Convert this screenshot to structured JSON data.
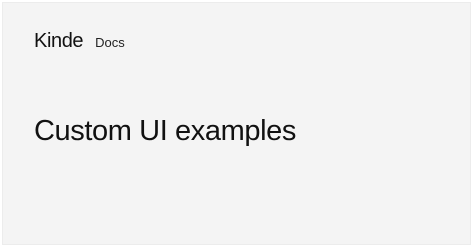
{
  "header": {
    "logo_text": "Kinde",
    "section_label": "Docs"
  },
  "main": {
    "title": "Custom UI examples"
  },
  "colors": {
    "background": "#f4f4f4",
    "text": "#111111"
  }
}
